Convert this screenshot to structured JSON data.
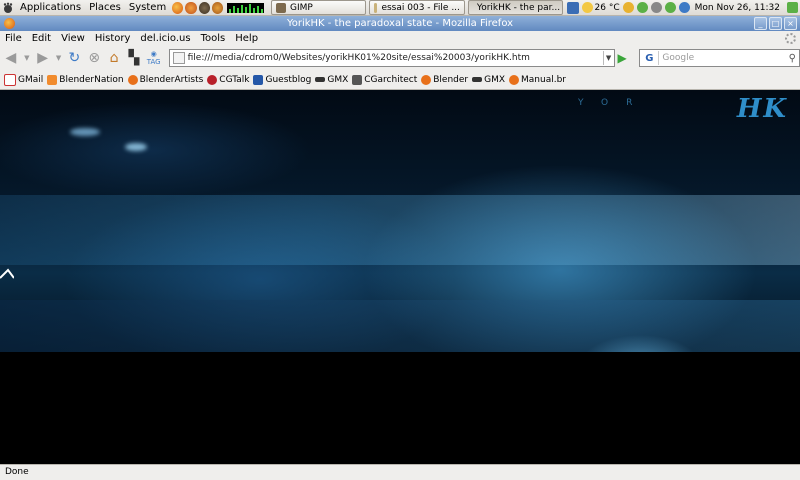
{
  "panel": {
    "menus": [
      "Applications",
      "Places",
      "System"
    ],
    "tasks": [
      {
        "label": "GIMP",
        "color": "#7d6a4e"
      },
      {
        "label": "essai 003 - File ...",
        "color": "#c9b27a"
      },
      {
        "label": "YorikHK - the par...",
        "color": "#e07a1f"
      }
    ],
    "weather": "26 °C",
    "clock": "Mon Nov 26, 11:32"
  },
  "window": {
    "title": "YorikHK - the paradoxal state - Mozilla Firefox",
    "buttons": [
      "_",
      "□",
      "×"
    ]
  },
  "menubar": [
    "File",
    "Edit",
    "View",
    "History",
    "del.icio.us",
    "Tools",
    "Help"
  ],
  "navbar": {
    "url": "file:///media/cdrom0/Websites/yorikHK01%20site/essai%20003/yorikHK.htm",
    "search_placeholder": "Google",
    "tag_label": "TAG"
  },
  "bookmarks": [
    {
      "label": "GMail",
      "icon": "gmail-icon",
      "color": "#ffffff"
    },
    {
      "label": "BlenderNation",
      "icon": "rss-icon",
      "color": "#f18b2d"
    },
    {
      "label": "BlenderArtists",
      "icon": "blender-icon",
      "color": "#e8701a"
    },
    {
      "label": "CGTalk",
      "icon": "cgtalk-icon",
      "color": "#b8202a"
    },
    {
      "label": "Guestblog",
      "icon": "blog-icon",
      "color": "#2457a8"
    },
    {
      "label": "GMX",
      "icon": "gmx-icon",
      "color": "#333333"
    },
    {
      "label": "CGarchitect",
      "icon": "cgarchitect-icon",
      "color": "#555555"
    },
    {
      "label": "Blender",
      "icon": "blender-icon",
      "color": "#e8701a"
    },
    {
      "label": "GMX",
      "icon": "gmx-icon",
      "color": "#333333"
    },
    {
      "label": "Manual.br",
      "icon": "blender-icon",
      "color": "#e8701a"
    }
  ],
  "content": {
    "logo_text": "HK",
    "logo_thin": "YOR"
  },
  "status": "Done"
}
